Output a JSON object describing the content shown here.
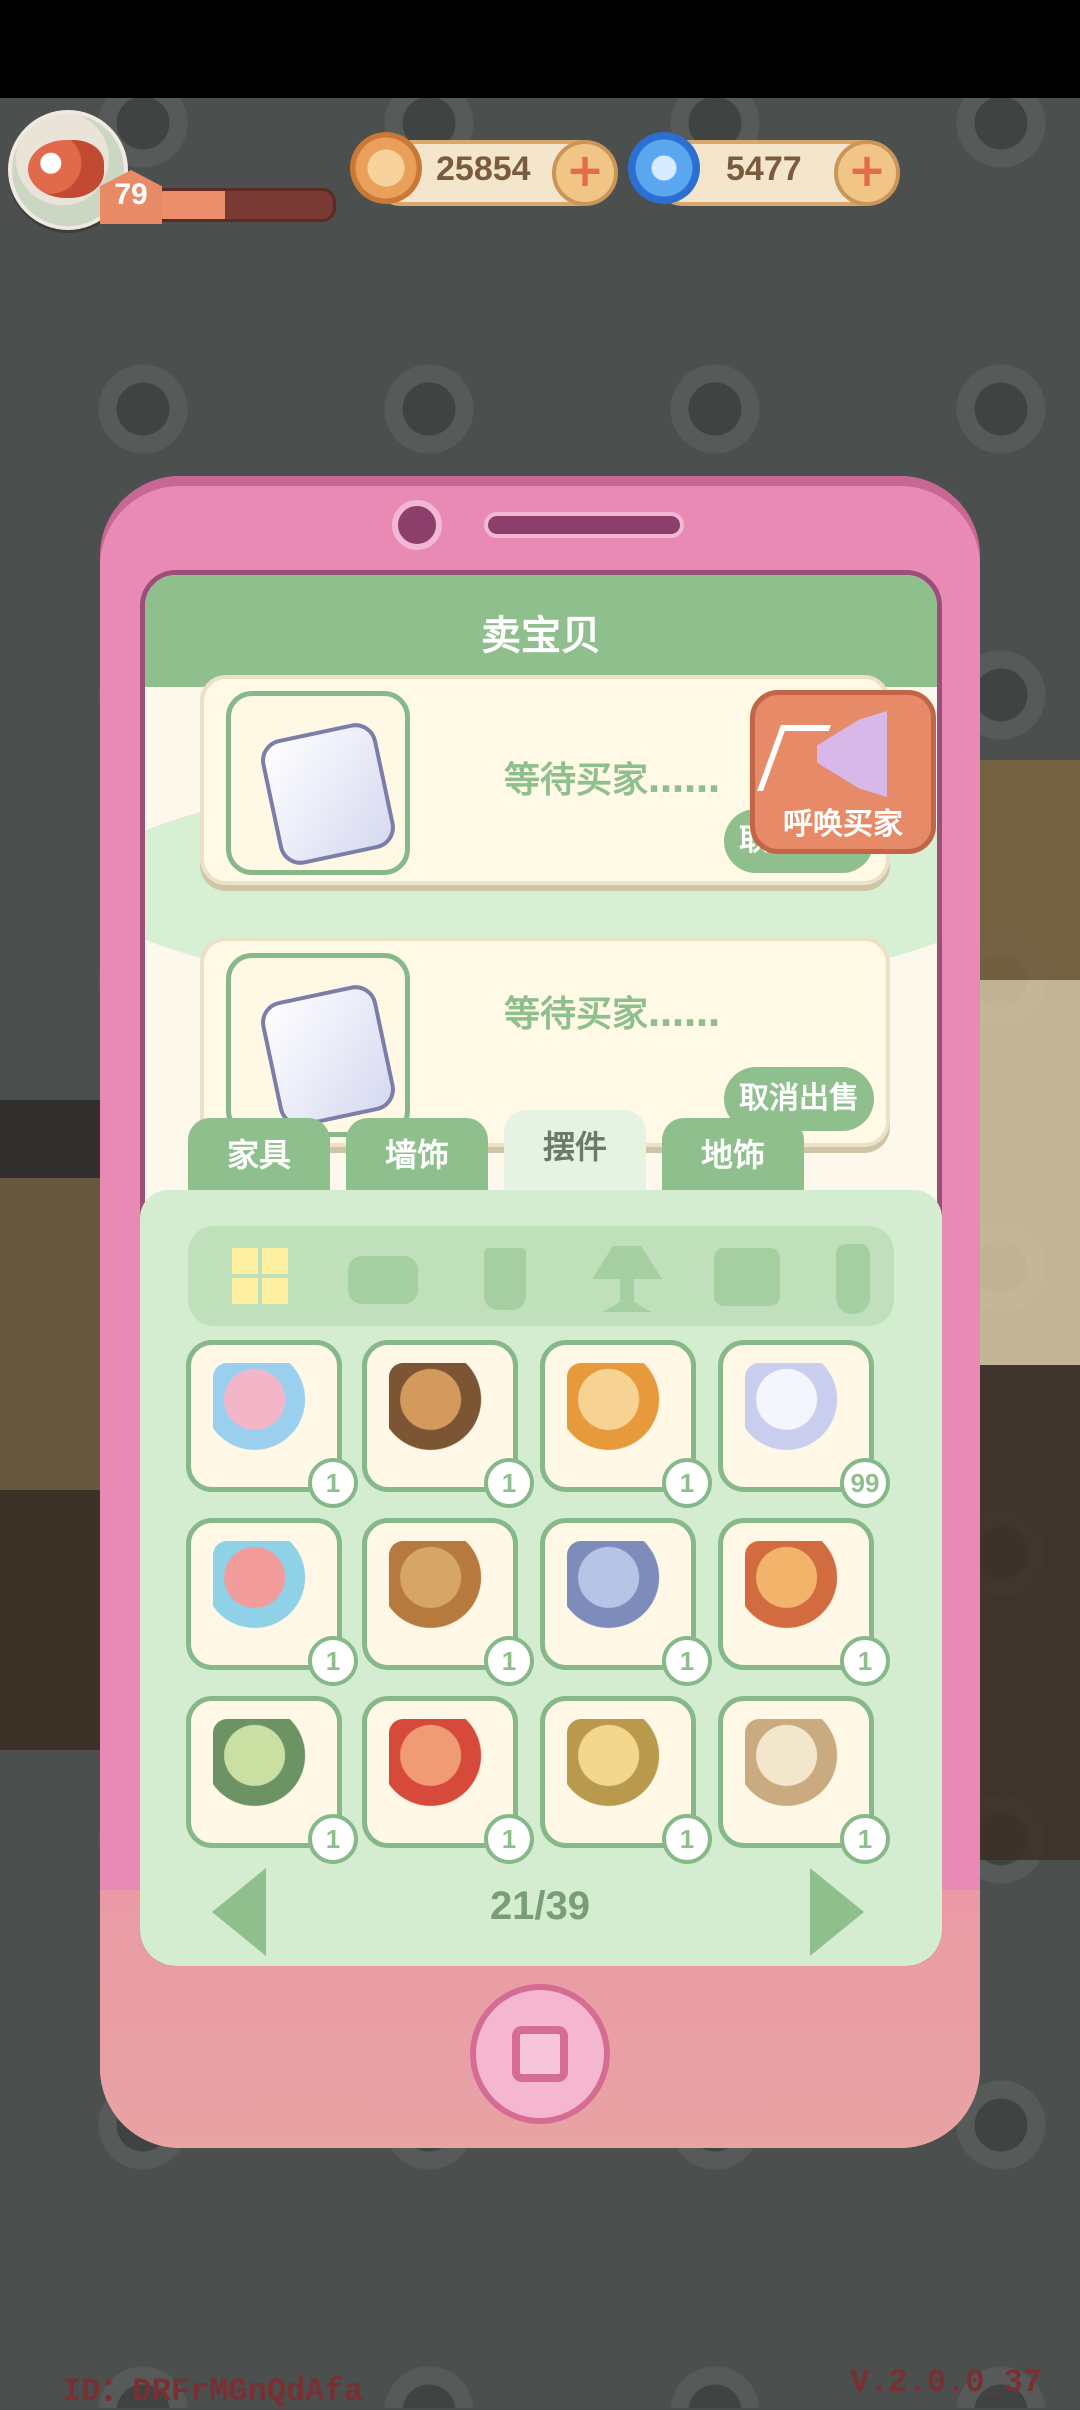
{
  "hud": {
    "level": "79",
    "xp_fraction": 0.4,
    "coins": {
      "value": "25854",
      "plus": "+"
    },
    "gems": {
      "value": "5477",
      "plus": "+"
    }
  },
  "screen": {
    "title": "卖宝贝",
    "listings": [
      {
        "status": "等待买家……",
        "cancel_label": "取消出售"
      },
      {
        "status": "等待买家……",
        "cancel_label": "取消出售"
      }
    ],
    "call_buyer_label": "呼唤买家"
  },
  "tabs": [
    {
      "label": "家具"
    },
    {
      "label": "墙饰"
    },
    {
      "label": "摆件"
    },
    {
      "label": "地饰"
    }
  ],
  "subcategories": [
    "all-icon",
    "pot-icon",
    "cup-icon",
    "lamp-icon",
    "frame-icon",
    "vase-icon"
  ],
  "inventory": [
    {
      "name": "angel-pig",
      "count": "1"
    },
    {
      "name": "owl-figure",
      "count": "1"
    },
    {
      "name": "box",
      "count": "1"
    },
    {
      "name": "pillow",
      "count": "99"
    },
    {
      "name": "stacking-rings",
      "count": "1"
    },
    {
      "name": "swordfish",
      "count": "1"
    },
    {
      "name": "airplane",
      "count": "1"
    },
    {
      "name": "tissue-box",
      "count": "1"
    },
    {
      "name": "teapot",
      "count": "1"
    },
    {
      "name": "koi-figure",
      "count": "1"
    },
    {
      "name": "kettle",
      "count": "1"
    },
    {
      "name": "vase",
      "count": "1"
    }
  ],
  "pager": {
    "text": "21/39"
  },
  "footer": {
    "id": "ID：DRFrMGnQdAfa",
    "version": "V.2.0.0_37"
  }
}
